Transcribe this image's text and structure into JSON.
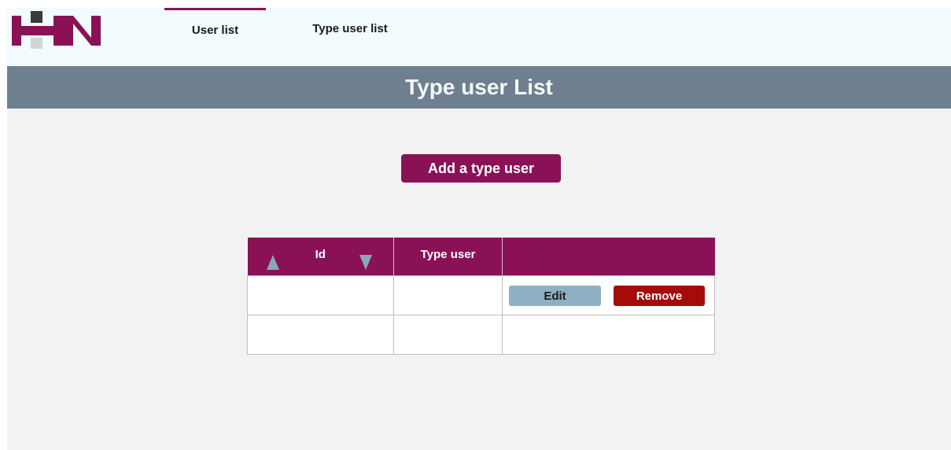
{
  "nav": {
    "tabs": [
      {
        "label": "User list",
        "active": true
      },
      {
        "label": "Type user list",
        "active": false
      }
    ]
  },
  "logo": {
    "icon": "hn-logo-icon",
    "colors": {
      "letters": "#8b1157",
      "dark_square": "#3a3a3a",
      "light_square": "#d3d3d3"
    }
  },
  "banner": {
    "title": "Type user List"
  },
  "actions": {
    "add_label": "Add a type user"
  },
  "table": {
    "columns": [
      "Id",
      "Type user",
      ""
    ],
    "sort_icons": {
      "asc": "sort-ascending-icon",
      "desc": "sort-descending-icon"
    },
    "rows": [
      {
        "id": "",
        "type_user": "",
        "edit_label": "Edit",
        "remove_label": "Remove"
      },
      {
        "id": "",
        "type_user": ""
      }
    ]
  },
  "colors": {
    "accent": "#8b1157",
    "banner": "#6e7f8f",
    "edit": "#8fb0c3",
    "remove": "#a50b0b",
    "nav_bg": "#f2fbfd",
    "page_bg": "#f2f2f2"
  }
}
